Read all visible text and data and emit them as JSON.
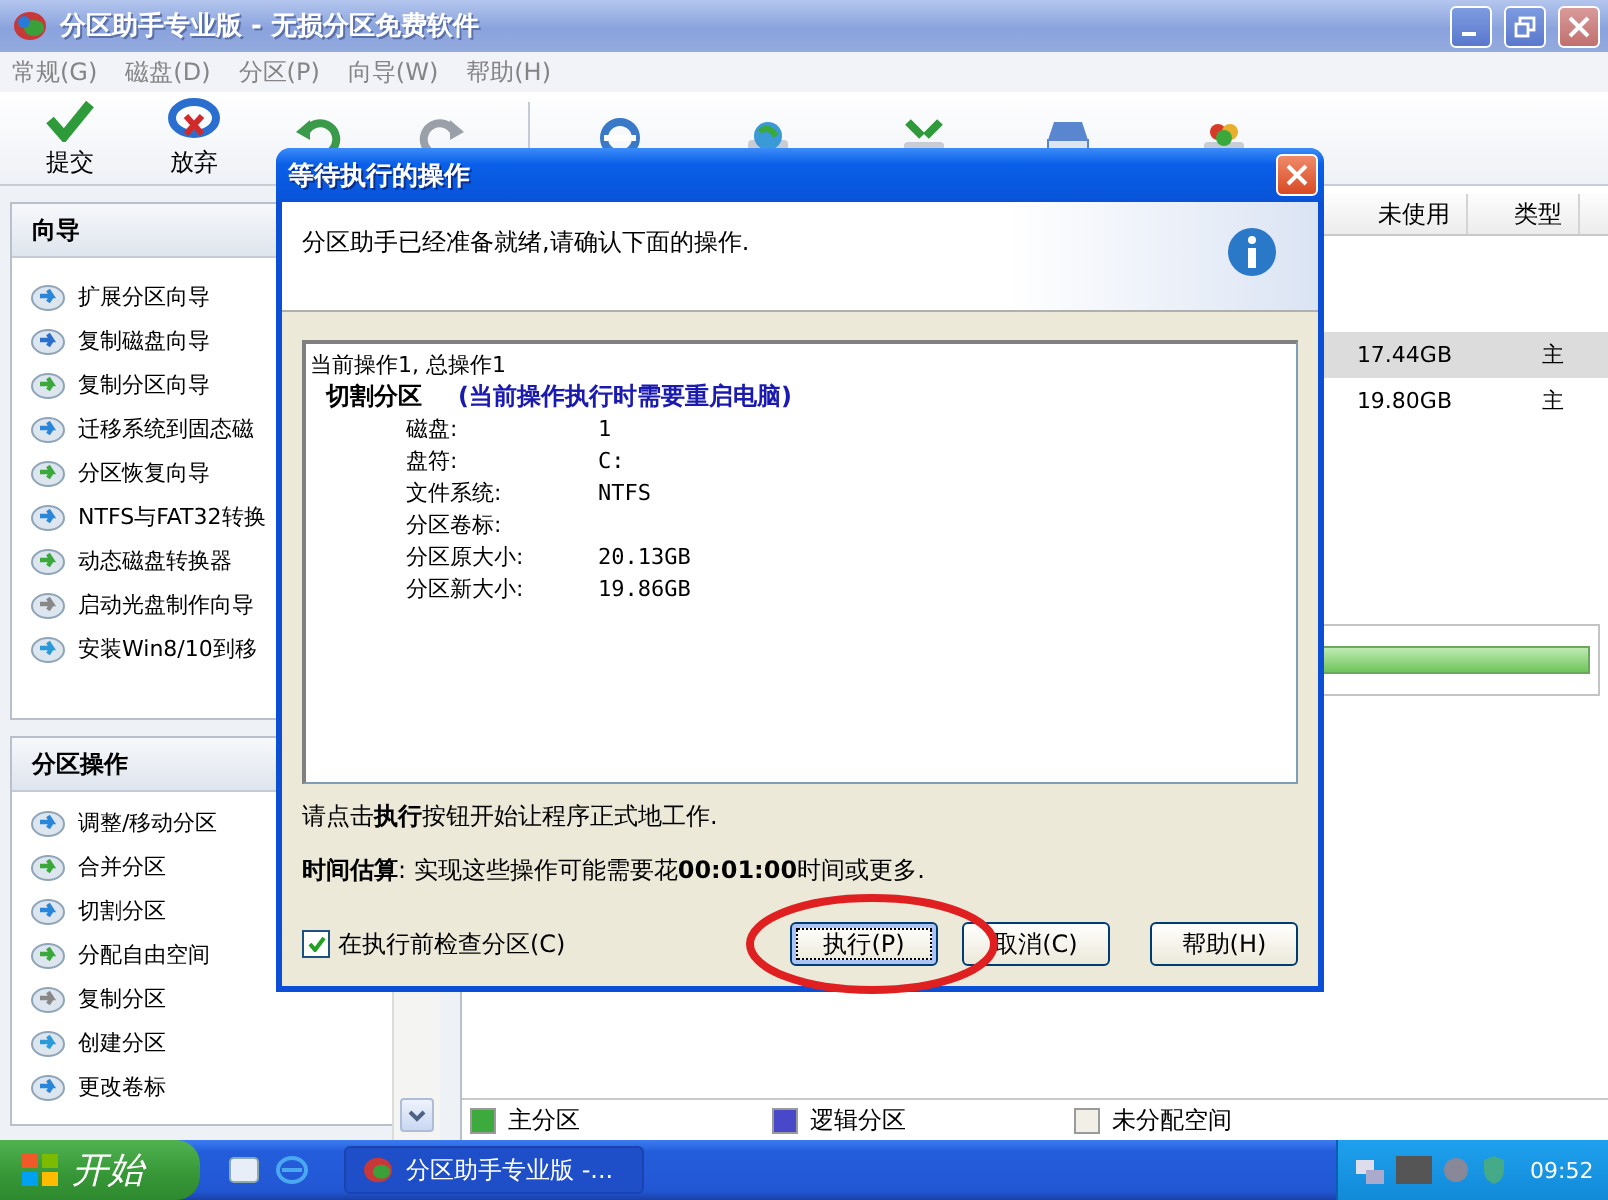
{
  "window": {
    "title": "分区助手专业版 - 无损分区免费软件"
  },
  "menu": [
    "常规(G)",
    "磁盘(D)",
    "分区(P)",
    "向导(W)",
    "帮助(H)"
  ],
  "toolbar": {
    "buttons": [
      "提交",
      "放弃"
    ]
  },
  "sidebar": {
    "sections": [
      {
        "title": "向导",
        "items": [
          "扩展分区向导",
          "复制磁盘向导",
          "复制分区向导",
          "迁移系统到固态磁",
          "分区恢复向导",
          "NTFS与FAT32转换",
          "动态磁盘转换器",
          "启动光盘制作向导",
          "安装Win8/10到移"
        ]
      },
      {
        "title": "分区操作",
        "items": [
          "调整/移动分区",
          "合并分区",
          "切割分区",
          "分配自由空间",
          "复制分区",
          "创建分区",
          "更改卷标"
        ]
      }
    ]
  },
  "table": {
    "columns": [
      "未使用",
      "类型"
    ],
    "rows": [
      {
        "cells": [
          "17.44GB",
          "主"
        ],
        "selected": true
      },
      {
        "cells": [
          "19.80GB",
          "主"
        ],
        "selected": false
      }
    ]
  },
  "legend": [
    {
      "label": "主分区",
      "color": "#3daa3d"
    },
    {
      "label": "逻辑分区",
      "color": "#4848c8"
    },
    {
      "label": "未分配空间",
      "color": "#f2f0e6"
    }
  ],
  "dialog": {
    "title": "等待执行的操作",
    "message": "分区助手已经准备就绪,请确认下面的操作.",
    "summary": "当前操作1, 总操作1",
    "operation": {
      "name": "切割分区",
      "note": "(当前操作执行时需要重启电脑)",
      "details": [
        {
          "label": "磁盘:",
          "value": "1"
        },
        {
          "label": "盘符:",
          "value": "C:"
        },
        {
          "label": "文件系统:",
          "value": "NTFS"
        },
        {
          "label": "分区卷标:"
        },
        {
          "label": "分区原大小:",
          "value": "20.13GB"
        },
        {
          "label": "分区新大小:",
          "value": "19.86GB"
        }
      ]
    },
    "instruction": "请点击**执行**按钮开始让程序正式地工作.",
    "estimate": "**时间估算**: 实现这些操作可能需要花**00:01:00**时间或更多.",
    "check_before": {
      "label": "在执行前检查分区(C)",
      "checked": true
    },
    "buttons": [
      {
        "label": "执行(P)",
        "default": true
      },
      {
        "label": "取消(C)",
        "default": false
      },
      {
        "label": "帮助(H)",
        "default": false
      }
    ]
  },
  "taskbar": {
    "start": "开始",
    "task": "分区助手专业版 -...",
    "clock": "09:52"
  }
}
